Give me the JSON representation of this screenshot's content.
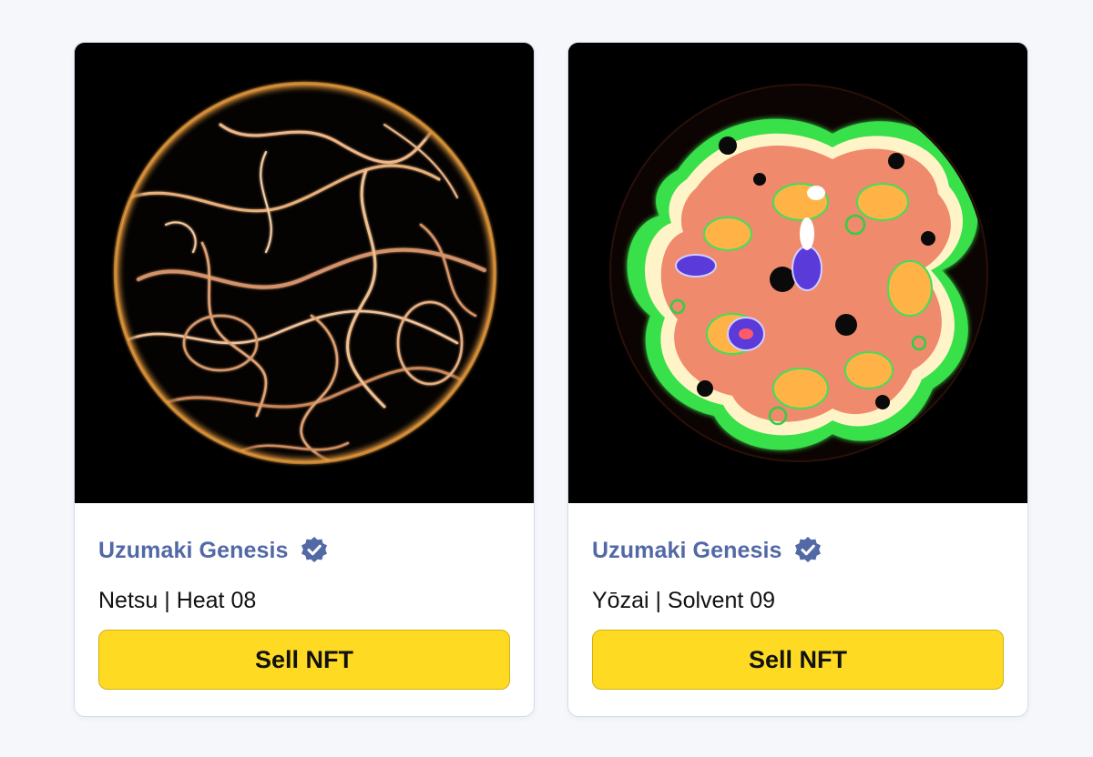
{
  "cards": [
    {
      "collection": "Uzumaki Genesis",
      "verified_icon": "verified-badge-icon",
      "name": "Netsu | Heat 08",
      "button_label": "Sell NFT"
    },
    {
      "collection": "Uzumaki Genesis",
      "verified_icon": "verified-badge-icon",
      "name": "Yōzai | Solvent 09",
      "button_label": "Sell NFT"
    }
  ],
  "colors": {
    "collection_text": "#5269a6",
    "button_bg": "#fedb22",
    "card_border": "#d3dcec",
    "page_bg": "#f6f7fa"
  }
}
